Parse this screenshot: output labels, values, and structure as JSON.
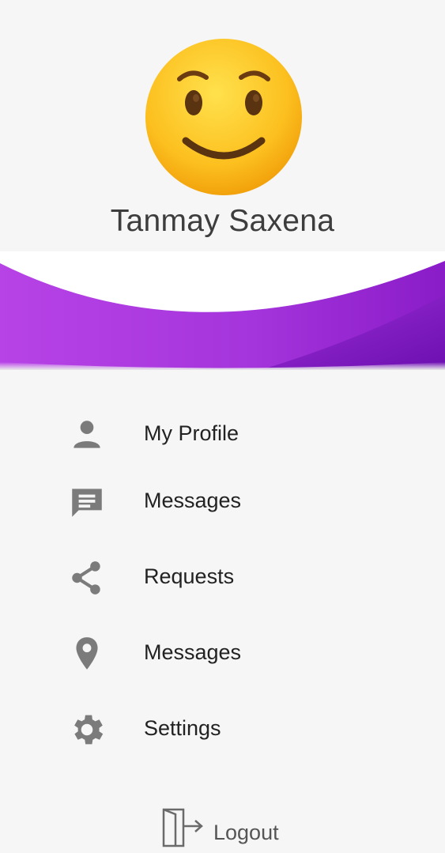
{
  "header": {
    "user_name": "Tanmay Saxena",
    "avatar_icon": "slightly-smiling-face-emoji",
    "accent_color": "#a52bd9"
  },
  "menu": {
    "items": [
      {
        "label": "My Profile",
        "icon": "person-icon"
      },
      {
        "label": "Messages",
        "icon": "message-icon"
      },
      {
        "label": "Requests",
        "icon": "share-icon"
      },
      {
        "label": "Messages",
        "icon": "location-pin-icon"
      },
      {
        "label": "Settings",
        "icon": "gear-icon"
      }
    ]
  },
  "footer": {
    "logout_label": "Logout",
    "logout_icon": "logout-icon"
  },
  "colors": {
    "background": "#f6f6f6",
    "icon_gray": "#7b7b7b",
    "text_dark": "#222222"
  }
}
